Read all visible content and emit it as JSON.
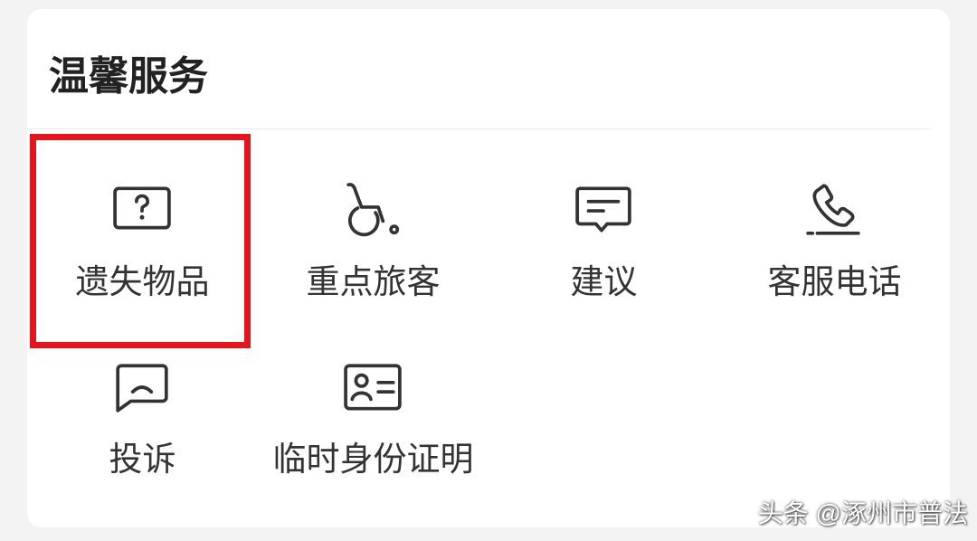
{
  "section": {
    "title": "温馨服务"
  },
  "services": [
    {
      "label": "遗失物品",
      "icon": "question-box-icon"
    },
    {
      "label": "重点旅客",
      "icon": "wheelchair-icon"
    },
    {
      "label": "建议",
      "icon": "message-icon"
    },
    {
      "label": "客服电话",
      "icon": "phone-icon"
    },
    {
      "label": "投诉",
      "icon": "complaint-icon"
    },
    {
      "label": "临时身份证明",
      "icon": "id-card-icon"
    }
  ],
  "highlight": {
    "color": "#e8141b"
  },
  "watermark": {
    "text": "头条 @涿州市普法"
  },
  "colors": {
    "background": "#f3f3f3",
    "card": "#ffffff",
    "text": "#333333",
    "title": "#222222"
  }
}
